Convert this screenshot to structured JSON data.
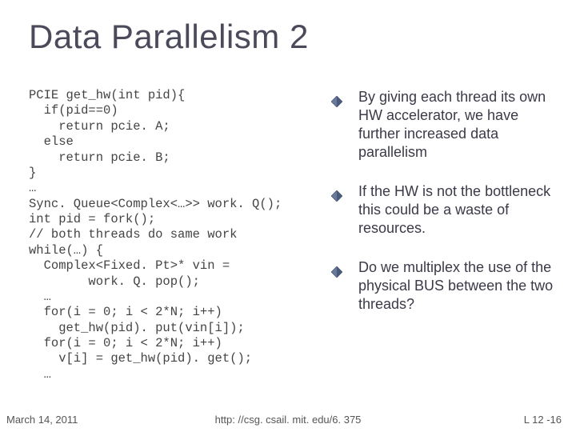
{
  "title": "Data Parallelism 2",
  "code": "PCIE get_hw(int pid){\n  if(pid==0)\n    return pcie. A;\n  else\n    return pcie. B;\n}\n…\nSync. Queue<Complex<…>> work. Q();\nint pid = fork();\n// both threads do same work\nwhile(…) {\n  Complex<Fixed. Pt>* vin =\n        work. Q. pop();\n  …\n  for(i = 0; i < 2*N; i++)\n    get_hw(pid). put(vin[i]);\n  for(i = 0; i < 2*N; i++)\n    v[i] = get_hw(pid). get();\n  …",
  "bullets": [
    "By giving each thread its own HW accelerator, we have further increased data parallelism",
    "If the HW is not the bottleneck this could be a waste of resources.",
    "Do we multiplex the use of the physical BUS between the two threads?"
  ],
  "footer": {
    "date": "March 14, 2011",
    "url": "http: //csg. csail. mit. edu/6. 375",
    "page": "L 12 -16"
  },
  "colors": {
    "diamond_fill": "#5a6a8a",
    "diamond_stroke": "#3a4a6a"
  }
}
